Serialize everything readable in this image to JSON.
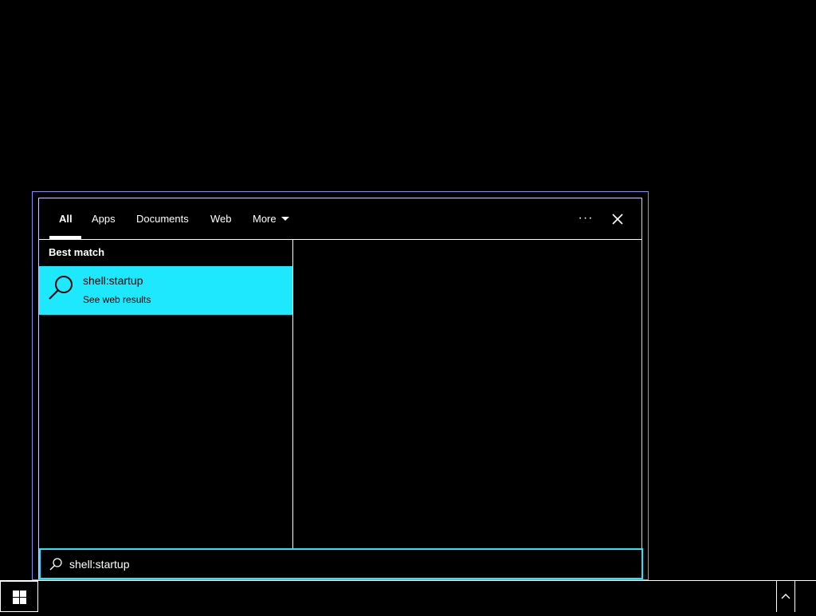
{
  "search": {
    "tabs": [
      {
        "label": "All",
        "active": true
      },
      {
        "label": "Apps",
        "active": false
      },
      {
        "label": "Documents",
        "active": false
      },
      {
        "label": "Web",
        "active": false
      },
      {
        "label": "More",
        "active": false
      }
    ],
    "options_label": "···",
    "best_match_header": "Best match",
    "result": {
      "title": "shell:startup",
      "subtitle": "See web results",
      "icon": "search-icon"
    },
    "query": "shell:startup"
  },
  "taskbar": {
    "start_icon": "windows-logo-icon",
    "tray_icon": "chevron-up-icon"
  },
  "colors": {
    "accent": "#1ee8fd",
    "background": "#000000",
    "text": "#ffffff",
    "flyout_border": "#8e8ef0"
  }
}
